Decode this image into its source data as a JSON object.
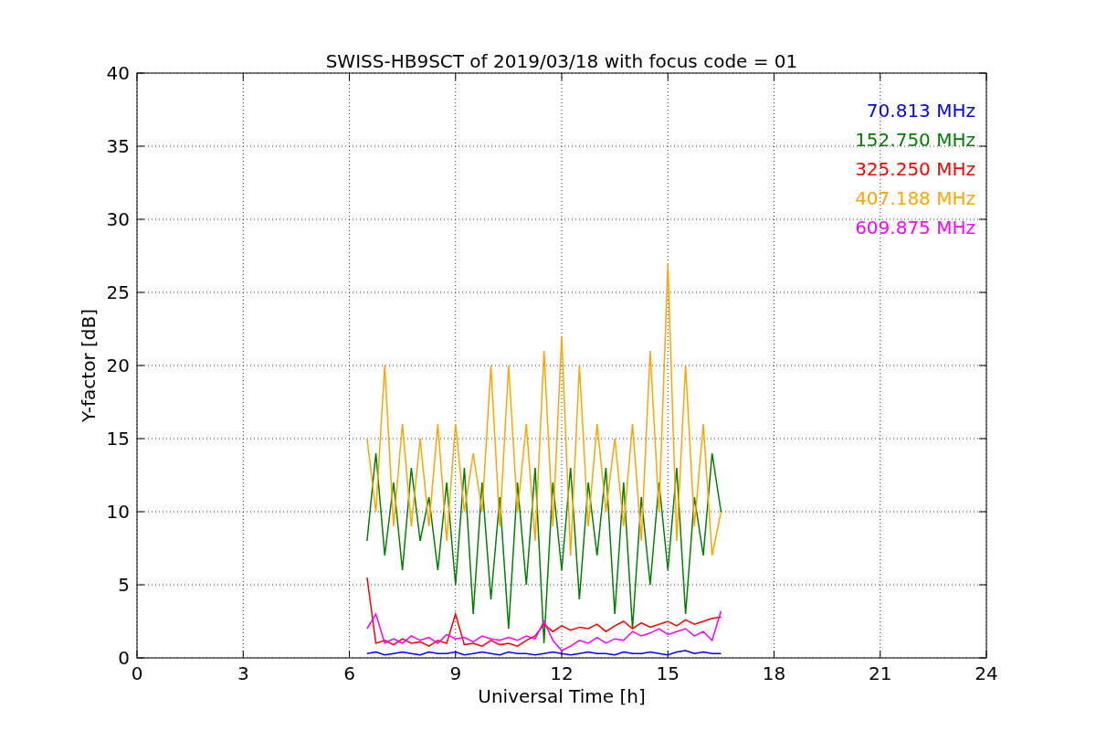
{
  "chart": {
    "chart_data": {
      "type": "line",
      "title": "SWISS-HB9SCT of 2019/03/18 with focus code = 01",
      "xlabel": "Universal Time [h]",
      "ylabel": "Y-factor [dB]",
      "grid": true,
      "xlim": [
        0,
        24
      ],
      "ylim": [
        0,
        40
      ],
      "xticks": [
        0,
        3,
        6,
        9,
        12,
        15,
        18,
        21,
        24
      ],
      "yticks": [
        0,
        5,
        10,
        15,
        20,
        25,
        30,
        35,
        40
      ],
      "x": [
        6.5,
        6.75,
        7,
        7.25,
        7.5,
        7.75,
        8,
        8.25,
        8.5,
        8.75,
        9,
        9.25,
        9.5,
        9.75,
        10,
        10.25,
        10.5,
        10.75,
        11,
        11.25,
        11.5,
        11.75,
        12,
        12.25,
        12.5,
        12.75,
        13,
        13.25,
        13.5,
        13.75,
        14,
        14.25,
        14.5,
        14.75,
        15,
        15.25,
        15.5,
        15.75,
        16,
        16.25,
        16.5
      ],
      "series": [
        {
          "name": "70.813 MHz",
          "color": "#0000ff",
          "values": [
            0.3,
            0.4,
            0.2,
            0.3,
            0.4,
            0.3,
            0.2,
            0.4,
            0.3,
            0.3,
            0.4,
            0.2,
            0.3,
            0.4,
            0.3,
            0.2,
            0.4,
            0.3,
            0.3,
            0.2,
            0.3,
            0.4,
            0.3,
            0.2,
            0.3,
            0.4,
            0.3,
            0.3,
            0.2,
            0.4,
            0.3,
            0.3,
            0.4,
            0.3,
            0.2,
            0.4,
            0.5,
            0.3,
            0.4,
            0.3,
            0.3
          ]
        },
        {
          "name": "152.750 MHz",
          "color": "#008000",
          "values": [
            8,
            14,
            7,
            12,
            6,
            13,
            8,
            11,
            6,
            12,
            5,
            13,
            3,
            12,
            4,
            11,
            2,
            12,
            5,
            13,
            1,
            12,
            6,
            13,
            4,
            12,
            7,
            13,
            3,
            12,
            2,
            11,
            5,
            12,
            6,
            13,
            3,
            11,
            7,
            14,
            10
          ]
        },
        {
          "name": "325.250 MHz",
          "color": "#ff0000",
          "values": [
            5.5,
            1,
            1.2,
            0.9,
            1.3,
            1,
            1.1,
            0.8,
            1.2,
            1,
            3,
            0.9,
            1,
            0.8,
            1.2,
            0.9,
            1,
            0.8,
            1.2,
            1.5,
            2.3,
            1.8,
            2.2,
            1.9,
            2.1,
            2,
            2.3,
            1.8,
            2.2,
            2.5,
            2,
            2.4,
            2.1,
            2.3,
            2.5,
            2.2,
            2.6,
            2.3,
            2.5,
            2.7,
            2.8
          ]
        },
        {
          "name": "407.188 MHz",
          "color": "#ffa500",
          "values": [
            15,
            10,
            20,
            9,
            16,
            9,
            15,
            9,
            16,
            8,
            16,
            10,
            14,
            10,
            20,
            9,
            20,
            10,
            16,
            8,
            21,
            9,
            22,
            7,
            20,
            9,
            16,
            10,
            15,
            9,
            16,
            8,
            21,
            10,
            27,
            8,
            20,
            9,
            16,
            7,
            10
          ]
        },
        {
          "name": "609.875 MHz",
          "color": "#ff00ff",
          "values": [
            2,
            3,
            1,
            1.3,
            1,
            1.5,
            1.2,
            1.4,
            1,
            1.6,
            1.3,
            1.4,
            1.1,
            1.5,
            1.3,
            1.2,
            1.4,
            1.2,
            1.5,
            1.3,
            2.5,
            1.2,
            0.5,
            0.8,
            1.2,
            1,
            1.4,
            1,
            1.3,
            1.2,
            1.8,
            1.5,
            1.7,
            2,
            1.6,
            1.8,
            2,
            1.5,
            1.8,
            1.2,
            3.2
          ]
        }
      ]
    }
  }
}
